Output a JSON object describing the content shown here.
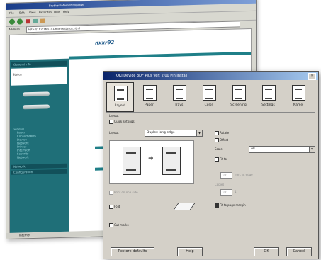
{
  "browser": {
    "title": "Brother Internet Explorer",
    "menu": [
      "File",
      "Edit",
      "View",
      "Favorites",
      "Tools",
      "Help"
    ],
    "address_label": "Address",
    "address_value": "http://192.168.0.1/home/status.html",
    "logo": "nxxr92",
    "sidebar": {
      "header": "General Info",
      "panel_text": "Status",
      "links": [
        "General",
        "Paper",
        "Consumables",
        "Device",
        "Network",
        "Printer",
        "Interface",
        "Security",
        "Network"
      ],
      "footer_items": [
        "Network",
        "Configuration"
      ],
      "bottom_status": "Internet"
    }
  },
  "dialog": {
    "title": "OKI Device 3DF Plus Ver: 2.00 Pin Install",
    "close_label": "x",
    "tabs": [
      {
        "label": "Layout",
        "icon": "layout-icon"
      },
      {
        "label": "Paper",
        "icon": "paper-icon"
      },
      {
        "label": "Trays",
        "icon": "trays-icon"
      },
      {
        "label": "Color",
        "icon": "color-icon"
      },
      {
        "label": "Screening",
        "icon": "screening-icon"
      },
      {
        "label": "Settings",
        "icon": "settings-icon"
      },
      {
        "label": "Name",
        "icon": "name-icon"
      }
    ],
    "section_title": "Layout",
    "quick_settings": "Quick settings",
    "layout_label": "Layout",
    "layout_value": "Duplex long edge",
    "print_on_one_side": "Print on one side",
    "fold": "Fold",
    "cut_marks": "Cut marks",
    "right": {
      "rotate": "Rotate",
      "offset": "Offset",
      "scale_label": "Scale",
      "scale_value": "All",
      "fit_to_label": "Fit to",
      "fit_value_1": "100",
      "fit_value_2": "100",
      "fit_note": "mm, at edge",
      "copies_label": "Copies",
      "copies_value": "1",
      "fit_to_page": "Fit to page margin"
    },
    "buttons": {
      "defaults": "Restore defaults",
      "help": "Help",
      "ok": "OK",
      "cancel": "Cancel"
    }
  }
}
